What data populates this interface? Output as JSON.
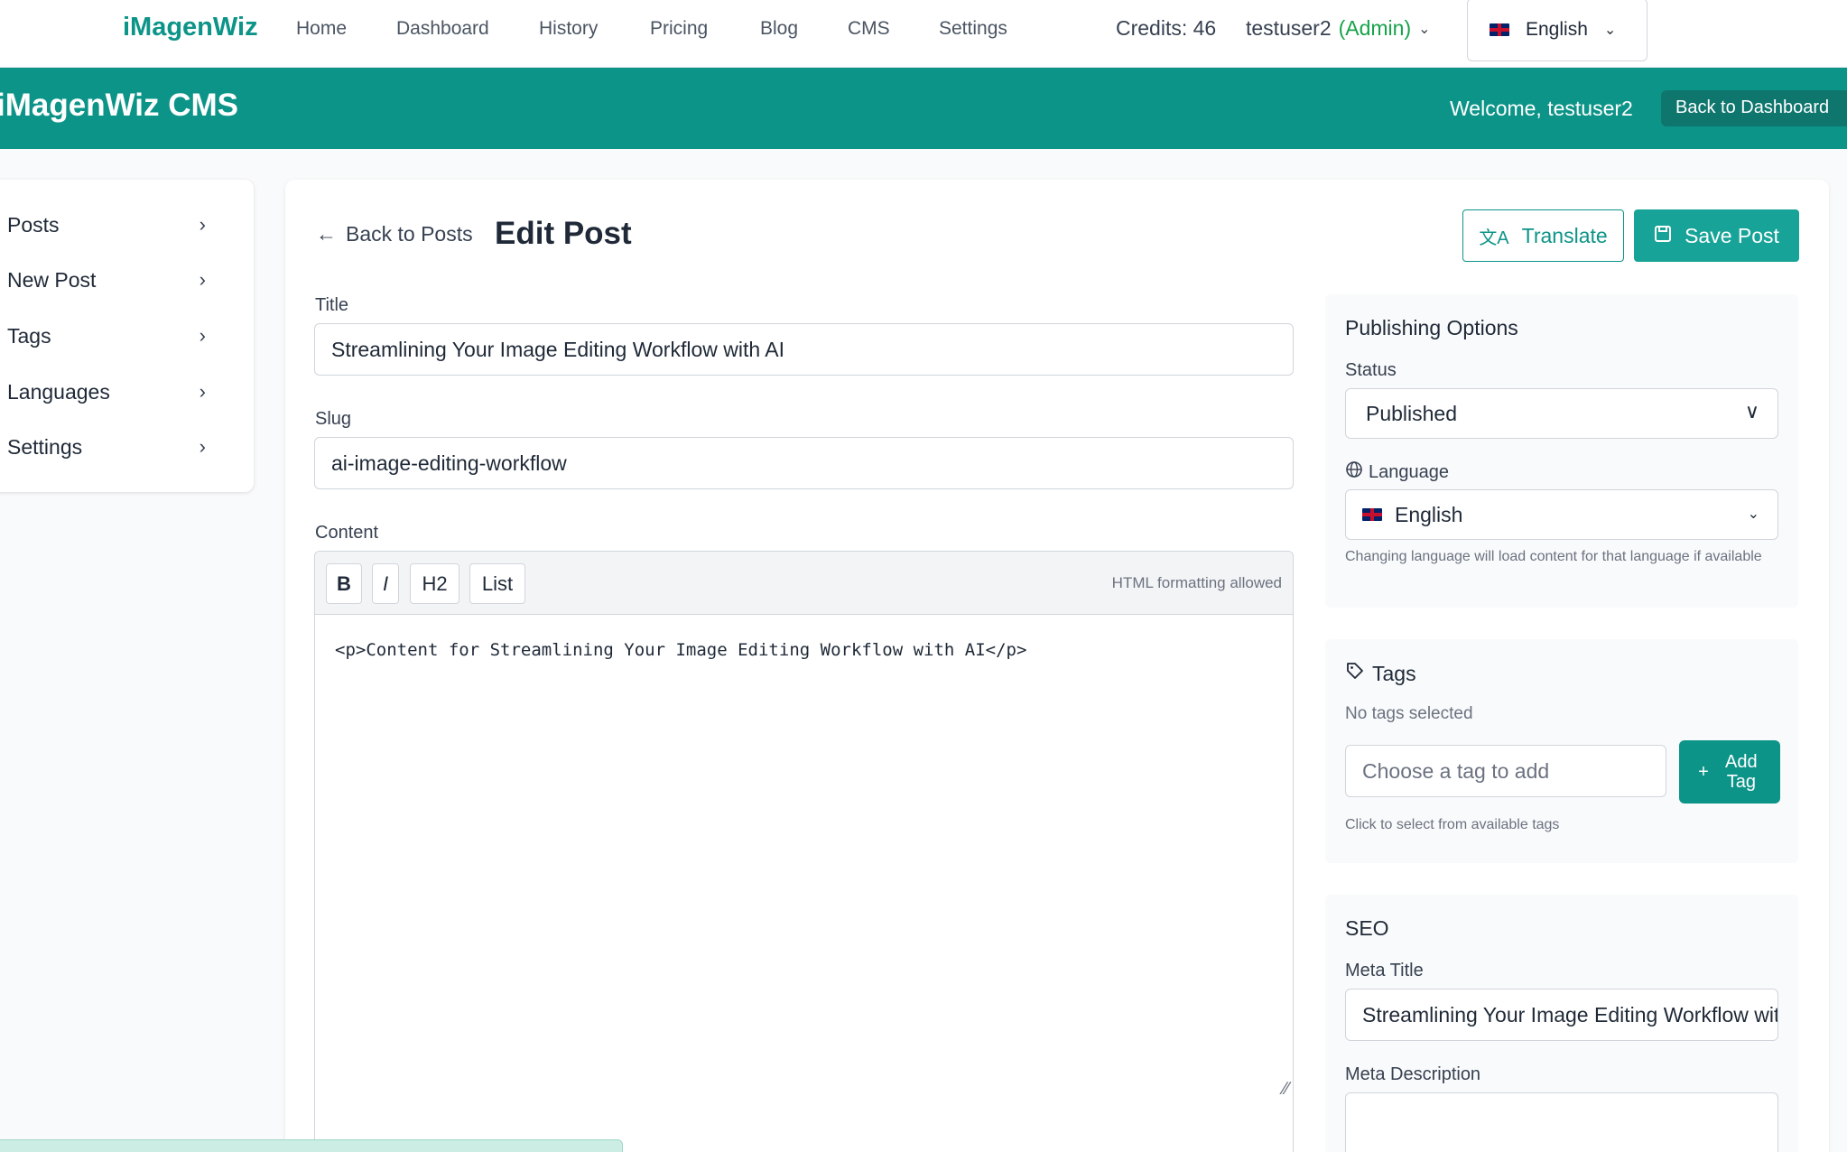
{
  "topnav": {
    "brand": "iMagenWiz",
    "links": [
      "Home",
      "Dashboard",
      "History",
      "Pricing",
      "Blog",
      "CMS",
      "Settings"
    ],
    "credits": "Credits: 46",
    "username": "testuser2",
    "role": "(Admin)",
    "language": "English"
  },
  "banner": {
    "title": "iMagenWiz CMS",
    "welcome": "Welcome, testuser2",
    "back_label": "Back to Dashboard"
  },
  "sidebar": {
    "items": [
      {
        "label": "Posts"
      },
      {
        "label": "New Post"
      },
      {
        "label": "Tags"
      },
      {
        "label": "Languages"
      },
      {
        "label": "Settings"
      }
    ]
  },
  "header": {
    "back_label": "Back to Posts",
    "title": "Edit Post",
    "translate_label": "Translate",
    "save_label": "Save Post"
  },
  "form": {
    "title_label": "Title",
    "title_value": "Streamlining Your Image Editing Workflow with AI",
    "slug_label": "Slug",
    "slug_value": "ai-image-editing-workflow",
    "content_label": "Content",
    "toolbar": {
      "bold": "B",
      "italic": "I",
      "h2": "H2",
      "list": "List",
      "hint": "HTML formatting allowed"
    },
    "content_value": "<p>Content for Streamlining Your Image Editing Workflow with AI</p>"
  },
  "publishing": {
    "title": "Publishing Options",
    "status_label": "Status",
    "status_value": "Published",
    "language_label": "Language",
    "language_value": "English",
    "language_hint": "Changing language will load content for that language if available"
  },
  "tags": {
    "title": "Tags",
    "empty": "No tags selected",
    "placeholder": "Choose a tag to add",
    "add_label": "Add Tag",
    "hint": "Click to select from available tags"
  },
  "seo": {
    "title": "SEO",
    "meta_title_label": "Meta Title",
    "meta_title_value": "Streamlining Your Image Editing Workflow with AI",
    "meta_desc_label": "Meta Description"
  },
  "colors": {
    "accent": "#0d9488",
    "admin": "#16a34a"
  }
}
